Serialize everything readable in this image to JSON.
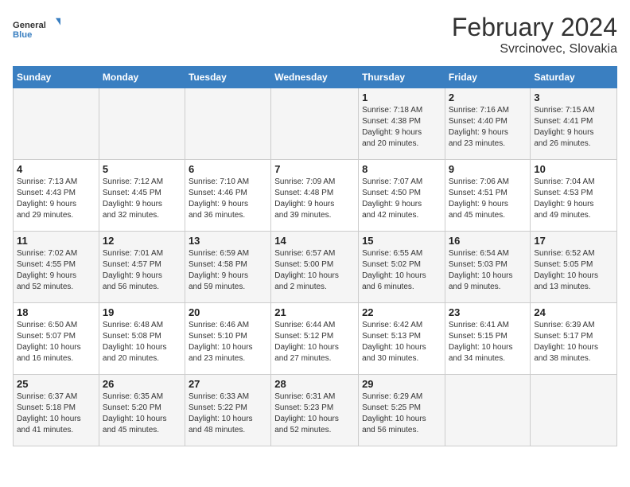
{
  "header": {
    "logo_line1": "General",
    "logo_line2": "Blue",
    "title": "February 2024",
    "subtitle": "Svrcinovec, Slovakia"
  },
  "weekdays": [
    "Sunday",
    "Monday",
    "Tuesday",
    "Wednesday",
    "Thursday",
    "Friday",
    "Saturday"
  ],
  "weeks": [
    [
      {
        "day": "",
        "info": ""
      },
      {
        "day": "",
        "info": ""
      },
      {
        "day": "",
        "info": ""
      },
      {
        "day": "",
        "info": ""
      },
      {
        "day": "1",
        "info": "Sunrise: 7:18 AM\nSunset: 4:38 PM\nDaylight: 9 hours\nand 20 minutes."
      },
      {
        "day": "2",
        "info": "Sunrise: 7:16 AM\nSunset: 4:40 PM\nDaylight: 9 hours\nand 23 minutes."
      },
      {
        "day": "3",
        "info": "Sunrise: 7:15 AM\nSunset: 4:41 PM\nDaylight: 9 hours\nand 26 minutes."
      }
    ],
    [
      {
        "day": "4",
        "info": "Sunrise: 7:13 AM\nSunset: 4:43 PM\nDaylight: 9 hours\nand 29 minutes."
      },
      {
        "day": "5",
        "info": "Sunrise: 7:12 AM\nSunset: 4:45 PM\nDaylight: 9 hours\nand 32 minutes."
      },
      {
        "day": "6",
        "info": "Sunrise: 7:10 AM\nSunset: 4:46 PM\nDaylight: 9 hours\nand 36 minutes."
      },
      {
        "day": "7",
        "info": "Sunrise: 7:09 AM\nSunset: 4:48 PM\nDaylight: 9 hours\nand 39 minutes."
      },
      {
        "day": "8",
        "info": "Sunrise: 7:07 AM\nSunset: 4:50 PM\nDaylight: 9 hours\nand 42 minutes."
      },
      {
        "day": "9",
        "info": "Sunrise: 7:06 AM\nSunset: 4:51 PM\nDaylight: 9 hours\nand 45 minutes."
      },
      {
        "day": "10",
        "info": "Sunrise: 7:04 AM\nSunset: 4:53 PM\nDaylight: 9 hours\nand 49 minutes."
      }
    ],
    [
      {
        "day": "11",
        "info": "Sunrise: 7:02 AM\nSunset: 4:55 PM\nDaylight: 9 hours\nand 52 minutes."
      },
      {
        "day": "12",
        "info": "Sunrise: 7:01 AM\nSunset: 4:57 PM\nDaylight: 9 hours\nand 56 minutes."
      },
      {
        "day": "13",
        "info": "Sunrise: 6:59 AM\nSunset: 4:58 PM\nDaylight: 9 hours\nand 59 minutes."
      },
      {
        "day": "14",
        "info": "Sunrise: 6:57 AM\nSunset: 5:00 PM\nDaylight: 10 hours\nand 2 minutes."
      },
      {
        "day": "15",
        "info": "Sunrise: 6:55 AM\nSunset: 5:02 PM\nDaylight: 10 hours\nand 6 minutes."
      },
      {
        "day": "16",
        "info": "Sunrise: 6:54 AM\nSunset: 5:03 PM\nDaylight: 10 hours\nand 9 minutes."
      },
      {
        "day": "17",
        "info": "Sunrise: 6:52 AM\nSunset: 5:05 PM\nDaylight: 10 hours\nand 13 minutes."
      }
    ],
    [
      {
        "day": "18",
        "info": "Sunrise: 6:50 AM\nSunset: 5:07 PM\nDaylight: 10 hours\nand 16 minutes."
      },
      {
        "day": "19",
        "info": "Sunrise: 6:48 AM\nSunset: 5:08 PM\nDaylight: 10 hours\nand 20 minutes."
      },
      {
        "day": "20",
        "info": "Sunrise: 6:46 AM\nSunset: 5:10 PM\nDaylight: 10 hours\nand 23 minutes."
      },
      {
        "day": "21",
        "info": "Sunrise: 6:44 AM\nSunset: 5:12 PM\nDaylight: 10 hours\nand 27 minutes."
      },
      {
        "day": "22",
        "info": "Sunrise: 6:42 AM\nSunset: 5:13 PM\nDaylight: 10 hours\nand 30 minutes."
      },
      {
        "day": "23",
        "info": "Sunrise: 6:41 AM\nSunset: 5:15 PM\nDaylight: 10 hours\nand 34 minutes."
      },
      {
        "day": "24",
        "info": "Sunrise: 6:39 AM\nSunset: 5:17 PM\nDaylight: 10 hours\nand 38 minutes."
      }
    ],
    [
      {
        "day": "25",
        "info": "Sunrise: 6:37 AM\nSunset: 5:18 PM\nDaylight: 10 hours\nand 41 minutes."
      },
      {
        "day": "26",
        "info": "Sunrise: 6:35 AM\nSunset: 5:20 PM\nDaylight: 10 hours\nand 45 minutes."
      },
      {
        "day": "27",
        "info": "Sunrise: 6:33 AM\nSunset: 5:22 PM\nDaylight: 10 hours\nand 48 minutes."
      },
      {
        "day": "28",
        "info": "Sunrise: 6:31 AM\nSunset: 5:23 PM\nDaylight: 10 hours\nand 52 minutes."
      },
      {
        "day": "29",
        "info": "Sunrise: 6:29 AM\nSunset: 5:25 PM\nDaylight: 10 hours\nand 56 minutes."
      },
      {
        "day": "",
        "info": ""
      },
      {
        "day": "",
        "info": ""
      }
    ]
  ]
}
